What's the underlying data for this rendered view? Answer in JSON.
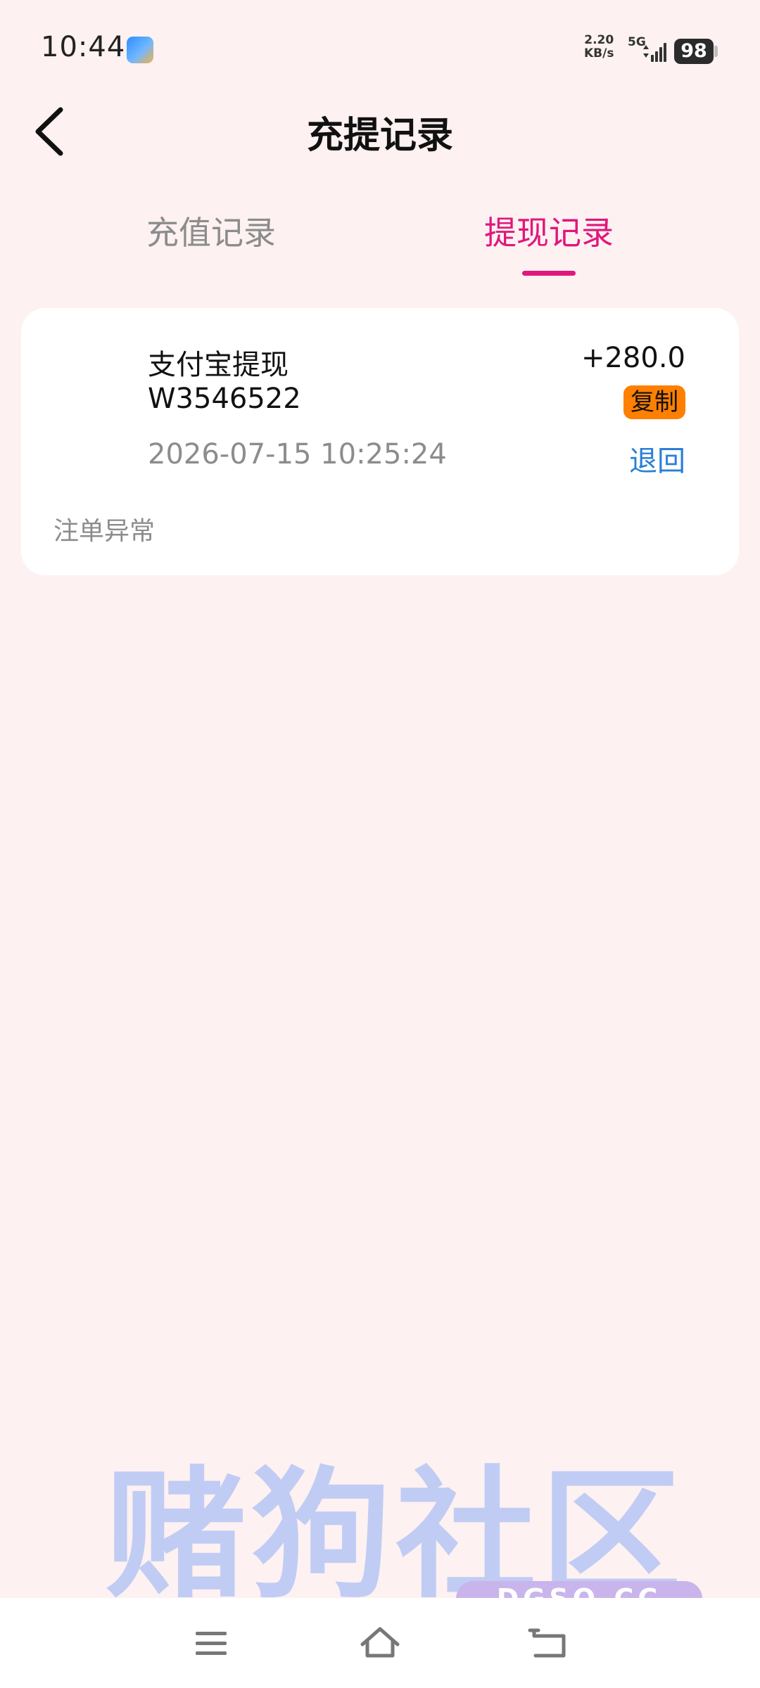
{
  "status_bar": {
    "time": "10:44",
    "net_speed_value": "2.20",
    "net_speed_unit": "KB/s",
    "network_type": "5G",
    "battery": "98"
  },
  "header": {
    "title": "充提记录",
    "back_icon": "chevron-left-icon"
  },
  "tabs": [
    {
      "label": "充值记录",
      "active": false
    },
    {
      "label": "提现记录",
      "active": true
    }
  ],
  "colors": {
    "accent": "#e0177c",
    "copy_badge": "#ff7f00",
    "status_link": "#2a7fd6",
    "background": "#fdf1f1"
  },
  "records": [
    {
      "method": "支付宝提现",
      "order_id": "W3546522",
      "amount": "+280.0",
      "copy_label": "复制",
      "time": "2026-07-15 10:25:24",
      "status": "退回",
      "note": "注单异常"
    }
  ],
  "watermark": {
    "text": "赌狗社区",
    "sub": "DGSQ.CC"
  },
  "nav_bar": {
    "icons": [
      "menu-icon",
      "home-icon",
      "back-icon"
    ]
  }
}
